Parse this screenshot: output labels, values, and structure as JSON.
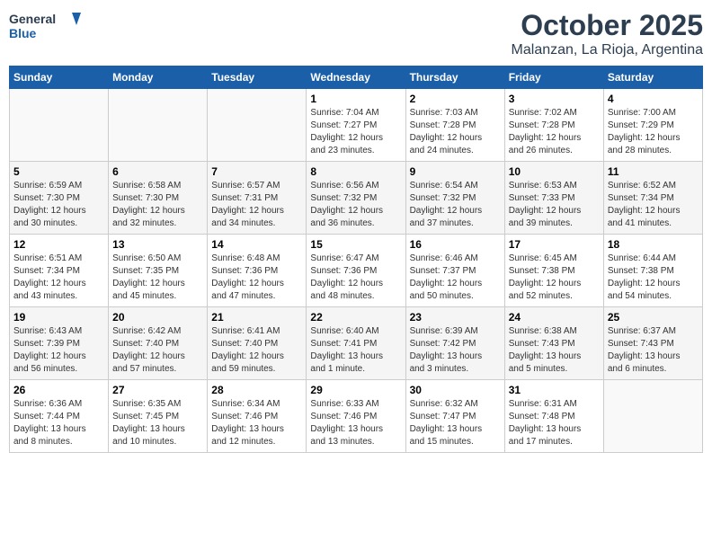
{
  "header": {
    "logo_line1": "General",
    "logo_line2": "Blue",
    "title": "October 2025",
    "subtitle": "Malanzan, La Rioja, Argentina"
  },
  "weekdays": [
    "Sunday",
    "Monday",
    "Tuesday",
    "Wednesday",
    "Thursday",
    "Friday",
    "Saturday"
  ],
  "weeks": [
    [
      {
        "day": "",
        "info": ""
      },
      {
        "day": "",
        "info": ""
      },
      {
        "day": "",
        "info": ""
      },
      {
        "day": "1",
        "info": "Sunrise: 7:04 AM\nSunset: 7:27 PM\nDaylight: 12 hours\nand 23 minutes."
      },
      {
        "day": "2",
        "info": "Sunrise: 7:03 AM\nSunset: 7:28 PM\nDaylight: 12 hours\nand 24 minutes."
      },
      {
        "day": "3",
        "info": "Sunrise: 7:02 AM\nSunset: 7:28 PM\nDaylight: 12 hours\nand 26 minutes."
      },
      {
        "day": "4",
        "info": "Sunrise: 7:00 AM\nSunset: 7:29 PM\nDaylight: 12 hours\nand 28 minutes."
      }
    ],
    [
      {
        "day": "5",
        "info": "Sunrise: 6:59 AM\nSunset: 7:30 PM\nDaylight: 12 hours\nand 30 minutes."
      },
      {
        "day": "6",
        "info": "Sunrise: 6:58 AM\nSunset: 7:30 PM\nDaylight: 12 hours\nand 32 minutes."
      },
      {
        "day": "7",
        "info": "Sunrise: 6:57 AM\nSunset: 7:31 PM\nDaylight: 12 hours\nand 34 minutes."
      },
      {
        "day": "8",
        "info": "Sunrise: 6:56 AM\nSunset: 7:32 PM\nDaylight: 12 hours\nand 36 minutes."
      },
      {
        "day": "9",
        "info": "Sunrise: 6:54 AM\nSunset: 7:32 PM\nDaylight: 12 hours\nand 37 minutes."
      },
      {
        "day": "10",
        "info": "Sunrise: 6:53 AM\nSunset: 7:33 PM\nDaylight: 12 hours\nand 39 minutes."
      },
      {
        "day": "11",
        "info": "Sunrise: 6:52 AM\nSunset: 7:34 PM\nDaylight: 12 hours\nand 41 minutes."
      }
    ],
    [
      {
        "day": "12",
        "info": "Sunrise: 6:51 AM\nSunset: 7:34 PM\nDaylight: 12 hours\nand 43 minutes."
      },
      {
        "day": "13",
        "info": "Sunrise: 6:50 AM\nSunset: 7:35 PM\nDaylight: 12 hours\nand 45 minutes."
      },
      {
        "day": "14",
        "info": "Sunrise: 6:48 AM\nSunset: 7:36 PM\nDaylight: 12 hours\nand 47 minutes."
      },
      {
        "day": "15",
        "info": "Sunrise: 6:47 AM\nSunset: 7:36 PM\nDaylight: 12 hours\nand 48 minutes."
      },
      {
        "day": "16",
        "info": "Sunrise: 6:46 AM\nSunset: 7:37 PM\nDaylight: 12 hours\nand 50 minutes."
      },
      {
        "day": "17",
        "info": "Sunrise: 6:45 AM\nSunset: 7:38 PM\nDaylight: 12 hours\nand 52 minutes."
      },
      {
        "day": "18",
        "info": "Sunrise: 6:44 AM\nSunset: 7:38 PM\nDaylight: 12 hours\nand 54 minutes."
      }
    ],
    [
      {
        "day": "19",
        "info": "Sunrise: 6:43 AM\nSunset: 7:39 PM\nDaylight: 12 hours\nand 56 minutes."
      },
      {
        "day": "20",
        "info": "Sunrise: 6:42 AM\nSunset: 7:40 PM\nDaylight: 12 hours\nand 57 minutes."
      },
      {
        "day": "21",
        "info": "Sunrise: 6:41 AM\nSunset: 7:40 PM\nDaylight: 12 hours\nand 59 minutes."
      },
      {
        "day": "22",
        "info": "Sunrise: 6:40 AM\nSunset: 7:41 PM\nDaylight: 13 hours\nand 1 minute."
      },
      {
        "day": "23",
        "info": "Sunrise: 6:39 AM\nSunset: 7:42 PM\nDaylight: 13 hours\nand 3 minutes."
      },
      {
        "day": "24",
        "info": "Sunrise: 6:38 AM\nSunset: 7:43 PM\nDaylight: 13 hours\nand 5 minutes."
      },
      {
        "day": "25",
        "info": "Sunrise: 6:37 AM\nSunset: 7:43 PM\nDaylight: 13 hours\nand 6 minutes."
      }
    ],
    [
      {
        "day": "26",
        "info": "Sunrise: 6:36 AM\nSunset: 7:44 PM\nDaylight: 13 hours\nand 8 minutes."
      },
      {
        "day": "27",
        "info": "Sunrise: 6:35 AM\nSunset: 7:45 PM\nDaylight: 13 hours\nand 10 minutes."
      },
      {
        "day": "28",
        "info": "Sunrise: 6:34 AM\nSunset: 7:46 PM\nDaylight: 13 hours\nand 12 minutes."
      },
      {
        "day": "29",
        "info": "Sunrise: 6:33 AM\nSunset: 7:46 PM\nDaylight: 13 hours\nand 13 minutes."
      },
      {
        "day": "30",
        "info": "Sunrise: 6:32 AM\nSunset: 7:47 PM\nDaylight: 13 hours\nand 15 minutes."
      },
      {
        "day": "31",
        "info": "Sunrise: 6:31 AM\nSunset: 7:48 PM\nDaylight: 13 hours\nand 17 minutes."
      },
      {
        "day": "",
        "info": ""
      }
    ]
  ]
}
